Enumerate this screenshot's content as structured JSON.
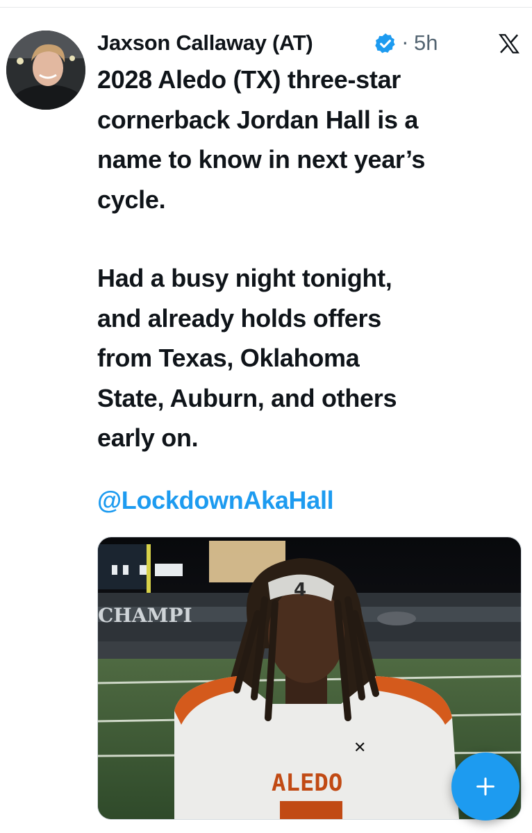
{
  "author": {
    "name": "Jaxson Callaway (AT)",
    "separator": "·",
    "time": "5h",
    "verified_icon": "verified-badge-icon",
    "avatar_icon": "avatar"
  },
  "tweet": {
    "lines": [
      "2028 Aledo (TX) three-star",
      "cornerback Jordan Hall is a",
      "name to know in next year’s",
      "cycle."
    ],
    "lines2": [
      "Had a busy night tonight,",
      "and already holds offers",
      "from Texas, Oklahoma",
      "State, Auburn, and others",
      "early on."
    ],
    "mention": "@LockdownAkaHall"
  },
  "media": {
    "jersey_text": "ALEDO",
    "stadium_sign": "CHAMPI",
    "headband_number": "4"
  },
  "fab": {
    "icon": "plus-icon"
  },
  "colors": {
    "accent": "#1d9bf0",
    "text": "#0f1419",
    "secondary": "#536471"
  }
}
